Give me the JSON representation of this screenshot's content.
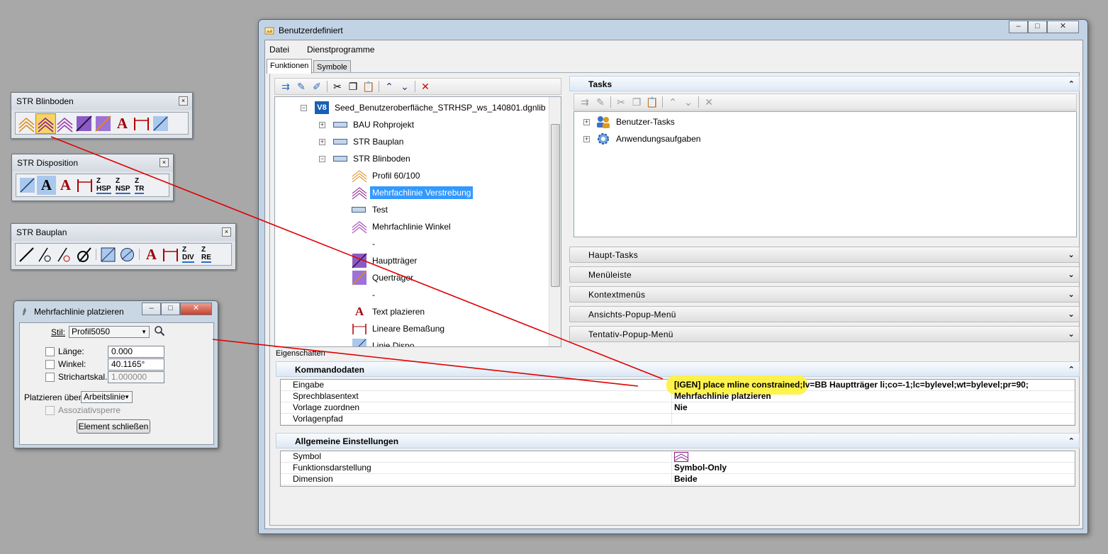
{
  "toolbar_blinboden": {
    "title": "STR Blinboden"
  },
  "toolbar_disposition": {
    "title": "STR Disposition",
    "z_labels": [
      "HSP",
      "NSP",
      "TR"
    ]
  },
  "toolbar_bauplan": {
    "title": "STR Bauplan",
    "z_labels": [
      "DIV",
      "RE"
    ]
  },
  "icon_glyphs": {
    "z": "Z",
    "text_a": "A"
  },
  "dialog": {
    "title": "Mehrfachlinie platzieren",
    "stil_label": "Stil:",
    "stil_value": "Profil5050",
    "laenge_label": "Länge:",
    "laenge_value": "0.000",
    "winkel_label": "Winkel:",
    "winkel_value": "40.1165°",
    "strichartskal_label": "Strichartskal.:",
    "strichartskal_value": "1.000000",
    "platzieren_label": "Platzieren über:",
    "platzieren_value": "Arbeitslinie",
    "assoziativsperre_label": "Assoziativsperre",
    "close_element_label": "Element schließen"
  },
  "window": {
    "title": "Benutzerdefiniert",
    "menu": [
      "Datei",
      "Dienstprogramme"
    ],
    "tabs": [
      "Funktionen",
      "Symbole"
    ]
  },
  "tree": {
    "root": "Seed_Benutzeroberfläche_STRHSP_ws_140801.dgnlib",
    "groups": [
      "BAU Rohprojekt",
      "STR Bauplan",
      "STR Blinboden"
    ],
    "items": [
      "Profil 60/100",
      "Mehrfachlinie Verstrebung",
      "Test",
      "Mehrfachlinie Winkel",
      "-",
      "Hauptträger",
      "Querträger",
      "-",
      "Text plazieren",
      "Lineare Bemaßung",
      "Linie Dispo"
    ],
    "selected": "Mehrfachlinie Verstrebung"
  },
  "tasks": {
    "title": "Tasks",
    "items": [
      "Benutzer-Tasks",
      "Anwendungsaufgaben"
    ],
    "collapsed_sections": [
      "Haupt-Tasks",
      "Menüleiste",
      "Kontextmenüs",
      "Ansichts-Popup-Menü",
      "Tentativ-Popup-Menü"
    ]
  },
  "properties": {
    "label": "Eigenschaften",
    "kommandodaten": {
      "title": "Kommandodaten",
      "rows": [
        {
          "key": "Eingabe",
          "value": "[IGEN] place mline constrained;lv=BB Hauptträger li;co=-1;lc=bylevel;wt=bylevel;pr=90;"
        },
        {
          "key": "Sprechblasentext",
          "value": "Mehrfachlinie platzieren"
        },
        {
          "key": "Vorlage zuordnen",
          "value": "Nie"
        },
        {
          "key": "Vorlagenpfad",
          "value": ""
        }
      ]
    },
    "allgemein": {
      "title": "Allgemeine Einstellungen",
      "rows": [
        {
          "key": "Symbol",
          "value": ""
        },
        {
          "key": "Funktionsdarstellung",
          "value": "Symbol-Only"
        },
        {
          "key": "Dimension",
          "value": "Beide"
        }
      ]
    }
  },
  "colors": {
    "accent_red": "#e00000",
    "selection_blue": "#3399ff",
    "highlight_yellow": "#fff23a",
    "section_blue": "#dde8f3"
  }
}
